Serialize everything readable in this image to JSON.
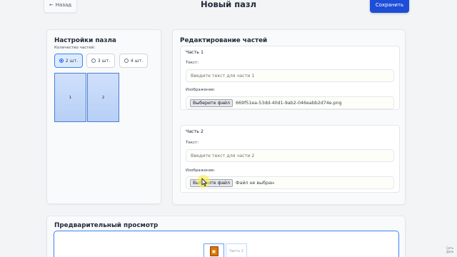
{
  "header": {
    "back_label": "Назад",
    "title": "Новый пазл",
    "save_label": "Сохранить"
  },
  "settings": {
    "title": "Настройки пазла",
    "count_label": "Количество частей:",
    "options": [
      "2 шт.",
      "3 шт.",
      "4 шт."
    ],
    "selected_option": "2 шт.",
    "pieces": [
      "1",
      "2"
    ]
  },
  "editing": {
    "title": "Редактирование частей",
    "parts": [
      {
        "title": "Часть 1",
        "text_label": "Текст:",
        "text_placeholder": "Введите текст для части 1",
        "image_label": "Изображение:",
        "file_button": "Выберите файл",
        "file_name": "669f51ea-53dd-40d1-9ab2-046eabb2d74e.png"
      },
      {
        "title": "Часть 2",
        "text_label": "Текст:",
        "text_placeholder": "Введите текст для части 2",
        "image_label": "Изображение:",
        "file_button": "Выберите файл",
        "file_name": "Файл не выбран"
      }
    ]
  },
  "preview": {
    "title": "Предварительный просмотр",
    "piece_2_label": "Часть 2"
  },
  "watermark": "Сеть Дзен"
}
